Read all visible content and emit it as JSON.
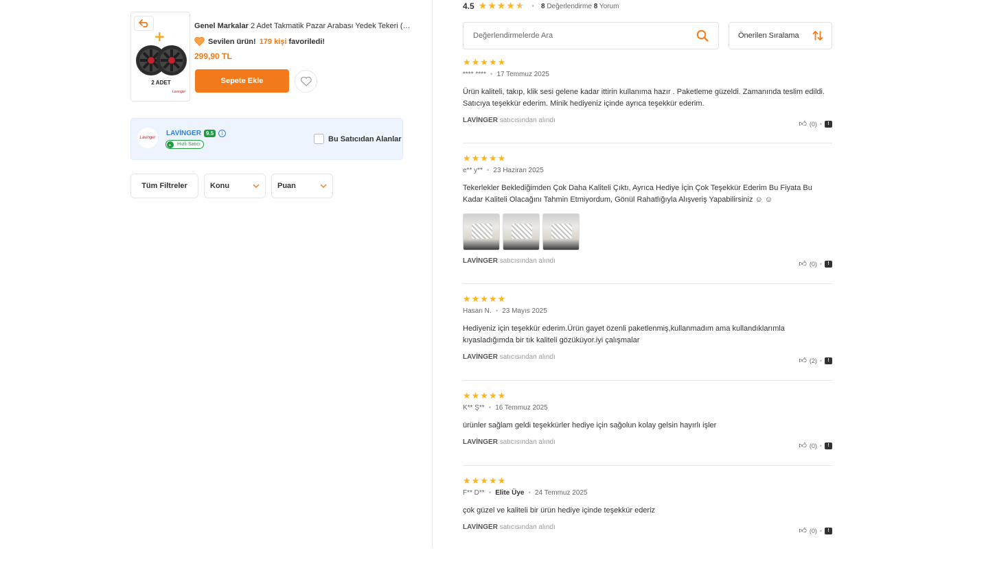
{
  "product": {
    "image_caption": "2 ADET",
    "image_logo": "Lavinger",
    "brand": "Genel Markalar",
    "title": "2 Adet Takmatik Pazar Arabası Yedek Tekeri (B...",
    "fav_prefix": "Sevilen ürün!",
    "fav_count": "179 kişi",
    "fav_suffix": "favoriledi!",
    "price": "299,90 TL",
    "add_to_cart": "Sepete Ekle"
  },
  "seller": {
    "logo": "Lavinger",
    "name": "LAVİNGER",
    "score": "9.5",
    "fast_badge": "Hızlı Satıcı",
    "filter_label": "Bu Satıcıdan Alanlar"
  },
  "filters": {
    "all": "Tüm Filtreler",
    "topic": "Konu",
    "rating": "Puan"
  },
  "summary": {
    "average": "4.5",
    "rating_value": 4.5,
    "rating_count": "8",
    "rating_label": "Değerlendirme",
    "review_count": "8",
    "review_label": "Yorum"
  },
  "search": {
    "placeholder": "Değerlendirmelerde Ara"
  },
  "sort": {
    "label": "Önerilen Sıralama"
  },
  "reviews": [
    {
      "stars": "★★★★★",
      "user": "**** ****",
      "date": "17 Temmuz 2025",
      "text": "Ürün kaliteli, takıp, klik sesi gelene kadar ittirin kullanıma hazır . Paketleme güzeldi. Zamanında teslim edildi. Satıcıya teşekkür ederim. Minik hediyeniz içinde ayrıca teşekkür ederim.",
      "seller": "LAVİNGER",
      "seller_suffix": "satıcısından alındı",
      "likes": "(0)"
    },
    {
      "stars": "★★★★★",
      "user": "e** y**",
      "date": "23 Haziran 2025",
      "text": "Tekerlekler Beklediğimden Çok Daha Kaliteli Çıktı, Ayrıca Hediye İçin Çok Teşekkür Ederim Bu Fiyata Bu Kadar Kaliteli Olacağını Tahmin Etmiyordum, Gönül Rahatlığıyla Alışveriş Yapabilirsiniz ☺ ☺",
      "seller": "LAVİNGER",
      "seller_suffix": "satıcısından alındı",
      "likes": "(0)"
    },
    {
      "stars": "★★★★★",
      "user": "Hasan N.",
      "date": "23 Mayıs 2025",
      "text": "Hediyeniz için teşekkür ederim.Ürün gayet özenli paketlenmiş,kullanmadım ama kullandıklarımla kıyasladığımda bir tık kaliteli gözüküyor.iyi çalışmalar",
      "seller": "LAVİNGER",
      "seller_suffix": "satıcısından alındı",
      "likes": "(2)"
    },
    {
      "stars": "★★★★★",
      "user": "K** Ş**",
      "date": "16 Temmuz 2025",
      "text": "ürünler sağlam geldi teşekkürler hediye için sağolun kolay gelsin hayırlı işler",
      "seller": "LAVİNGER",
      "seller_suffix": "satıcısından alındı",
      "likes": "(0)"
    },
    {
      "stars": "★★★★★",
      "user": "F** D**",
      "badge": "Elite Üye",
      "date": "24 Temmuz 2025",
      "text": "çok güzel ve kaliteli bir ürün hediye içinde teşekkür ederiz",
      "seller": "LAVİNGER",
      "seller_suffix": "satıcısından alındı",
      "likes": "(0)"
    }
  ],
  "colors": {
    "accent": "#f27a1a",
    "star": "#ffb41e",
    "seller_blue": "#2f7fd6",
    "seller_bg": "#eef4fd",
    "fast_green": "#1c9c3e"
  }
}
